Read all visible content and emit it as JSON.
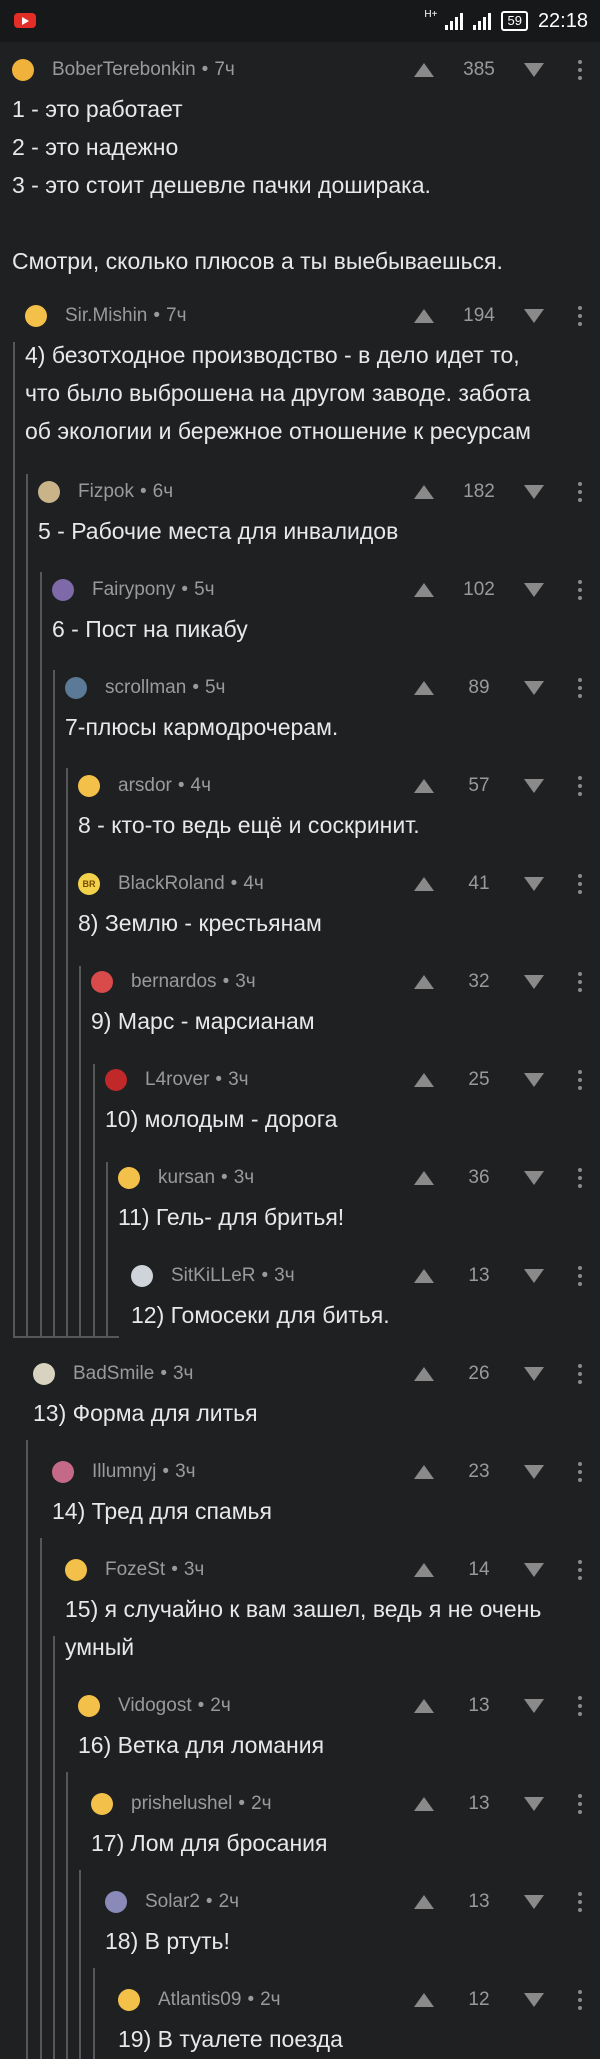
{
  "status_bar": {
    "network": "H+",
    "battery": "59",
    "time": "22:18"
  },
  "comments": [
    {
      "author": "BoberTerebonkin",
      "time": "7ч",
      "score": "385",
      "avatar": "",
      "lines": [
        "1 - это работает",
        "2 - это надежно",
        "3 - это стоит дешевле пачки доширака.",
        "",
        "Смотри, сколько плюсов а ты выебываешься."
      ]
    },
    {
      "author": "Sir.Mishin",
      "time": "7ч",
      "score": "194",
      "avatar": "",
      "lines": [
        "4) безотходное производство - в дело идет то,",
        "что было выброшена на другом заводе. забота",
        "об экологии и бережное отношение к ресурсам"
      ]
    },
    {
      "author": "Fizpok",
      "time": "6ч",
      "score": "182",
      "avatar": "",
      "lines": [
        "5 - Рабочие места для инвалидов"
      ]
    },
    {
      "author": "Fairypony",
      "time": "5ч",
      "score": "102",
      "avatar": "",
      "lines": [
        "6 - Пост на пикабу"
      ]
    },
    {
      "author": "scrollman",
      "time": "5ч",
      "score": "89",
      "avatar": "",
      "lines": [
        "7-плюсы кармодрочерам."
      ]
    },
    {
      "author": "arsdor",
      "time": "4ч",
      "score": "57",
      "avatar": "",
      "lines": [
        "8 - кто-то ведь ещё и соскринит."
      ]
    },
    {
      "author": "BlackRoland",
      "time": "4ч",
      "score": "41",
      "avatar": "BR",
      "lines": [
        "8) Землю - крестьянам"
      ]
    },
    {
      "author": "bernardos",
      "time": "3ч",
      "score": "32",
      "avatar": "",
      "lines": [
        "9) Марс - марсианам"
      ]
    },
    {
      "author": "L4rover",
      "time": "3ч",
      "score": "25",
      "avatar": "",
      "lines": [
        "10) молодым - дорога"
      ]
    },
    {
      "author": "kursan",
      "time": "3ч",
      "score": "36",
      "avatar": "",
      "lines": [
        "11) Гель- для бритья!"
      ]
    },
    {
      "author": "SitKiLLeR",
      "time": "3ч",
      "score": "13",
      "avatar": "",
      "lines": [
        "12) Гомосеки для битья."
      ]
    },
    {
      "author": "BadSmile",
      "time": "3ч",
      "score": "26",
      "avatar": "",
      "lines": [
        "13) Форма для литья"
      ]
    },
    {
      "author": "Illumnyj",
      "time": "3ч",
      "score": "23",
      "avatar": "",
      "lines": [
        "14) Тред для спамья"
      ]
    },
    {
      "author": "FozeSt",
      "time": "3ч",
      "score": "14",
      "avatar": "",
      "lines": [
        "15) я случайно к вам зашел, ведь я не очень",
        "умный"
      ]
    },
    {
      "author": "Vidogost",
      "time": "2ч",
      "score": "13",
      "avatar": "",
      "lines": [
        "16) Ветка для ломания"
      ]
    },
    {
      "author": "prishelushel",
      "time": "2ч",
      "score": "13",
      "avatar": "",
      "lines": [
        "17) Лом для бросания"
      ]
    },
    {
      "author": "Solar2",
      "time": "2ч",
      "score": "13",
      "avatar": "",
      "lines": [
        "18) В ртуть!"
      ]
    },
    {
      "author": "Atlantis09",
      "time": "2ч",
      "score": "12",
      "avatar": "",
      "lines": [
        "19) В туалете поезда"
      ]
    }
  ],
  "colors": {
    "background": "#1f2022",
    "text": "#e8e8e8",
    "muted": "#9a9a9a",
    "thread_line": "#55575a",
    "avatar_default": "#f3c04a"
  }
}
